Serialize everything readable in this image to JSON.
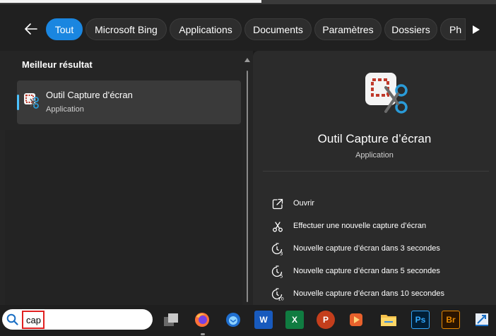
{
  "filters": {
    "back_icon": "arrow-left-icon",
    "items": [
      "Tout",
      "Microsoft Bing",
      "Applications",
      "Documents",
      "Paramètres",
      "Dossiers",
      "Ph"
    ],
    "active": "Tout",
    "next_icon": "play-next-icon"
  },
  "results": {
    "section_title": "Meilleur résultat",
    "best": {
      "name": "Outil Capture d’écran",
      "type": "Application"
    }
  },
  "details": {
    "title": "Outil Capture d’écran",
    "type": "Application",
    "actions": [
      {
        "icon": "open-icon",
        "label": "Ouvrir"
      },
      {
        "icon": "capture-icon",
        "label": "Effectuer une nouvelle capture d’écran"
      },
      {
        "icon": "timer-3-icon",
        "label": "Nouvelle capture d’écran dans 3 secondes"
      },
      {
        "icon": "timer-5-icon",
        "label": "Nouvelle capture d’écran dans 5 secondes"
      },
      {
        "icon": "timer-10-icon",
        "label": "Nouvelle capture d’écran dans 10 secondes"
      }
    ]
  },
  "taskbar": {
    "search_value": "cap",
    "icons": [
      {
        "name": "task-view-icon",
        "label": ""
      },
      {
        "name": "firefox-icon",
        "label": ""
      },
      {
        "name": "thunderbird-icon",
        "label": ""
      },
      {
        "name": "word-icon",
        "label": "W"
      },
      {
        "name": "excel-icon",
        "label": "X"
      },
      {
        "name": "powerpoint-icon",
        "label": "P"
      },
      {
        "name": "media-player-icon",
        "label": ""
      },
      {
        "name": "file-explorer-icon",
        "label": ""
      },
      {
        "name": "photoshop-icon",
        "label": "Ps"
      },
      {
        "name": "bridge-icon",
        "label": "Br"
      },
      {
        "name": "app-icon",
        "label": ""
      }
    ]
  },
  "colors": {
    "accent": "#1a86e0",
    "highlight_border": "#e02020",
    "word": "#185abd",
    "excel": "#107c41",
    "powerpoint": "#c43e1c",
    "photoshop": "#31a8ff",
    "bridge": "#e88a00"
  }
}
